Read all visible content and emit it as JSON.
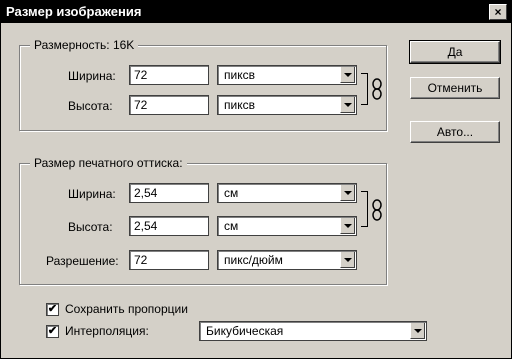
{
  "window": {
    "title": "Размер изображения",
    "close_glyph": "×"
  },
  "pixel_dims": {
    "legend": "Размерность:  16K",
    "width_label": "Ширина:",
    "width_value": "72",
    "width_unit": "пиксв",
    "height_label": "Высота:",
    "height_value": "72",
    "height_unit": "пиксв"
  },
  "print_size": {
    "legend": "Размер печатного оттиска:",
    "width_label": "Ширина:",
    "width_value": "2,54",
    "width_unit": "см",
    "height_label": "Высота:",
    "height_value": "2,54",
    "height_unit": "см",
    "resolution_label": "Разрешение:",
    "resolution_value": "72",
    "resolution_unit": "пикс/дюйм"
  },
  "options": {
    "constrain_label": "Сохранить пропорции",
    "constrain_checked": true,
    "resample_label": "Интерполяция:",
    "resample_checked": true,
    "resample_method": "Бикубическая",
    "check_glyph": "✔"
  },
  "buttons": {
    "ok": "Да",
    "cancel": "Отменить",
    "auto": "Авто..."
  }
}
